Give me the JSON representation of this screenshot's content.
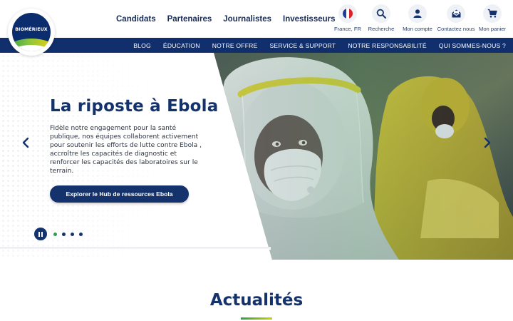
{
  "brand": {
    "logo_text": "BIOMÉRIEUX"
  },
  "audience_nav": [
    "Candidats",
    "Partenaires",
    "Journalistes",
    "Investisseurs"
  ],
  "utility_nav": [
    {
      "label": "France, FR",
      "icon": "france-flag-icon"
    },
    {
      "label": "Recherche",
      "icon": "search-icon"
    },
    {
      "label": "Mon compte",
      "icon": "user-icon"
    },
    {
      "label": "Contactez nous",
      "icon": "mail-icon"
    },
    {
      "label": "Mon panier",
      "icon": "cart-icon"
    }
  ],
  "main_nav": [
    "BLOG",
    "ÉDUCATION",
    "NOTRE OFFRE",
    "SERVICE & SUPPORT",
    "NOTRE RESPONSABILITÉ",
    "QUI SOMMES-NOUS ?"
  ],
  "hero": {
    "title": "La riposte à Ebola",
    "text": "Fidèle notre engagement pour la santé publique, nos équipes collaborent activement pour soutenir les efforts de lutte contre Ebola , accroître les capacités de diagnostic et renforcer les capacités des laboratoires sur le terrain.",
    "cta": "Explorer le Hub de ressources Ebola",
    "slides_count": 4,
    "active_slide": 1
  },
  "news": {
    "title": "Actualités"
  },
  "colors": {
    "navy": "#112f6c",
    "accent_green": "#2f9e48",
    "accent_yellow": "#c8d400"
  }
}
